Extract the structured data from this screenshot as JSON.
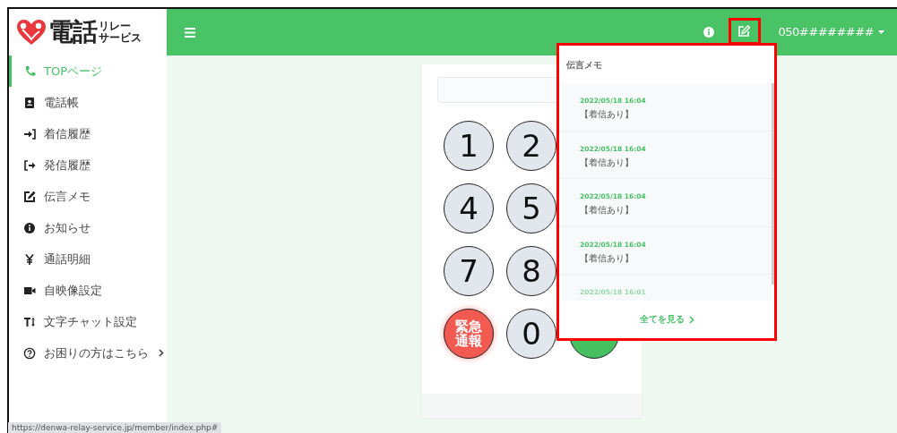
{
  "logo": {
    "main": "電話",
    "top": "リレー",
    "bottom": "サービス"
  },
  "sidebar": {
    "items": [
      {
        "label": "TOPページ",
        "selected": true,
        "submenu": false
      },
      {
        "label": "電話帳",
        "selected": false,
        "submenu": false
      },
      {
        "label": "着信履歴",
        "selected": false,
        "submenu": false
      },
      {
        "label": "発信履歴",
        "selected": false,
        "submenu": false
      },
      {
        "label": "伝言メモ",
        "selected": false,
        "submenu": false
      },
      {
        "label": "お知らせ",
        "selected": false,
        "submenu": false
      },
      {
        "label": "通話明細",
        "selected": false,
        "submenu": false
      },
      {
        "label": "自映像設定",
        "selected": false,
        "submenu": false
      },
      {
        "label": "文字チャット設定",
        "selected": false,
        "submenu": false
      },
      {
        "label": "お困りの方はこちら",
        "selected": false,
        "submenu": true
      }
    ]
  },
  "header": {
    "account": "050########"
  },
  "keypad": {
    "keys": [
      {
        "kind": "digit",
        "label": "1"
      },
      {
        "kind": "digit",
        "label": "2"
      },
      {
        "kind": "blank"
      },
      {
        "kind": "digit",
        "label": "4"
      },
      {
        "kind": "digit",
        "label": "5"
      },
      {
        "kind": "blank"
      },
      {
        "kind": "digit",
        "label": "7"
      },
      {
        "kind": "digit",
        "label": "8"
      },
      {
        "kind": "blank"
      },
      {
        "kind": "emergency",
        "label": "緊急通報"
      },
      {
        "kind": "digit",
        "label": "0"
      },
      {
        "kind": "call"
      }
    ]
  },
  "memo_dropdown": {
    "title": "伝言メモ",
    "items": [
      {
        "date": "2022/05/18 16:04",
        "text": "【着信あり】",
        "faded": false
      },
      {
        "date": "2022/05/18 16:04",
        "text": "【着信あり】",
        "faded": false
      },
      {
        "date": "2022/05/18 16:04",
        "text": "【着信あり】",
        "faded": false
      },
      {
        "date": "2022/05/18 16:04",
        "text": "【着信あり】",
        "faded": false
      },
      {
        "date": "2022/05/18 16:01",
        "faded": true
      }
    ],
    "footer": "全てを見る"
  },
  "status_bar": {
    "url": "https://denwa-relay-service.jp/member/index.php#"
  }
}
